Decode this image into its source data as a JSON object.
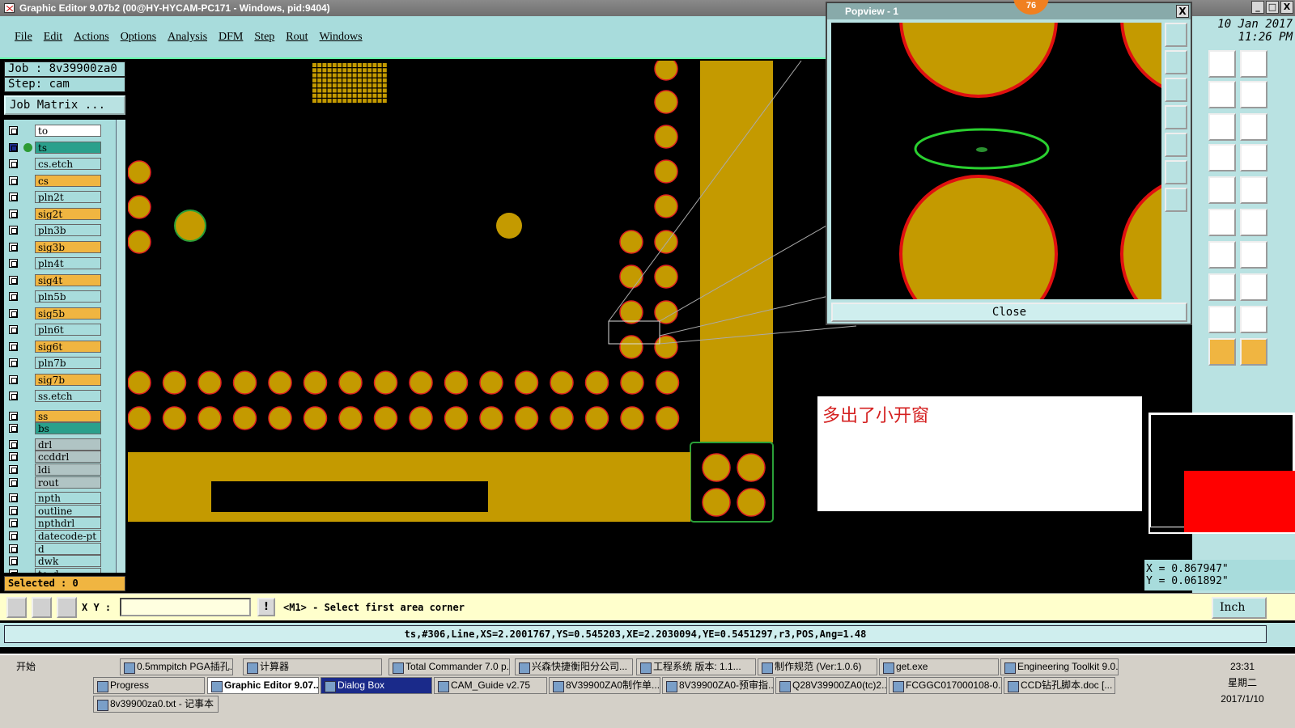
{
  "app": {
    "title": "Graphic Editor 9.07b2 (00@HY-HYCAM-PC171 - Windows, pid:9404)",
    "win_buttons": [
      "_",
      "□",
      "X"
    ]
  },
  "menu": [
    "File",
    "Edit",
    "Actions",
    "Options",
    "Analysis",
    "DFM",
    "Step",
    "Rout",
    "Windows"
  ],
  "job": {
    "label": "Job  : 8v39900za0",
    "step": "Step: cam",
    "matrix": "Job Matrix ..."
  },
  "layers": [
    {
      "name": "to",
      "color": "#ffffff"
    },
    {
      "name": "ts",
      "color": "#2aa08c",
      "active": true
    },
    {
      "name": "cs.etch",
      "color": "#a8dcdc"
    },
    {
      "name": "cs",
      "color": "#f0b541"
    },
    {
      "name": "pln2t",
      "color": "#a8dcdc"
    },
    {
      "name": "sig2t",
      "color": "#f0b541"
    },
    {
      "name": "pln3b",
      "color": "#a8dcdc"
    },
    {
      "name": "sig3b",
      "color": "#f0b541"
    },
    {
      "name": "pln4t",
      "color": "#a8dcdc"
    },
    {
      "name": "sig4t",
      "color": "#f0b541"
    },
    {
      "name": "pln5b",
      "color": "#a8dcdc"
    },
    {
      "name": "sig5b",
      "color": "#f0b541"
    },
    {
      "name": "pln6t",
      "color": "#a8dcdc"
    },
    {
      "name": "sig6t",
      "color": "#f0b541"
    },
    {
      "name": "pln7b",
      "color": "#a8dcdc"
    },
    {
      "name": "sig7b",
      "color": "#f0b541"
    },
    {
      "name": "ss.etch",
      "color": "#a8dcdc"
    },
    {
      "name": "ss",
      "color": "#f0b541"
    },
    {
      "name": "bs",
      "color": "#2aa08c"
    },
    {
      "name": "drl",
      "color": "#b0c4c4"
    },
    {
      "name": "ccddrl",
      "color": "#b0c4c4"
    },
    {
      "name": "ldi",
      "color": "#b0c4c4"
    },
    {
      "name": "rout",
      "color": "#b0c4c4"
    },
    {
      "name": "npth",
      "color": "#a8dcdc"
    },
    {
      "name": "outline",
      "color": "#a8dcdc"
    },
    {
      "name": "npthdrl",
      "color": "#a8dcdc"
    },
    {
      "name": "datecode-pt",
      "color": "#a8dcdc"
    },
    {
      "name": "d",
      "color": "#a8dcdc"
    },
    {
      "name": "dwk",
      "color": "#a8dcdc"
    },
    {
      "name": "to_d",
      "color": "#a8dcdc"
    }
  ],
  "selected": "Selected : 0",
  "command": {
    "xy_label": "X Y :",
    "xy_value": "",
    "warn": "!",
    "prompt": "<M1> - Select first area corner",
    "unit": "Inch"
  },
  "status": "ts,#306,Line,XS=2.2001767,YS=0.545203,XE=2.2030094,YE=0.5451297,r3,POS,Ang=1.48",
  "popview": {
    "title": "Popview - 1",
    "close": "Close",
    "badge": "76",
    "x": "X"
  },
  "datetime": {
    "date": "10 Jan 2017",
    "time": "11:26 PM"
  },
  "coords": {
    "x": "X = 0.867947\"",
    "y": "Y = 0.061892\""
  },
  "note": "多出了小开窗",
  "colors": {
    "copper": "#c49a00",
    "pad_ring": "#e02020",
    "green": "#2aa038",
    "panel": "#a8dcdc"
  },
  "taskbar": {
    "start": "开始",
    "clock_time": "23:31",
    "clock_day": "星期二",
    "clock_date": "2017/1/10",
    "row1": [
      "0.5mmpitch PGA插孔...",
      "计算器",
      "Total Commander 7.0 p...",
      "兴森快捷衡阳分公司...",
      "工程系统  版本: 1.1...",
      "制作规范 (Ver:1.0.6)",
      "get.exe",
      "Engineering Toolkit 9.0..."
    ],
    "row2": [
      "Progress",
      "Graphic Editor 9.07...",
      "Dialog Box",
      "CAM_Guide v2.75",
      "8V39900ZA0制作单....",
      "8V39900ZA0-预审指...",
      "Q28V39900ZA0(tc)2...",
      "FCGGC017000108-0...",
      "CCD钻孔脚本.doc [..."
    ],
    "row3": [
      "8v39900za0.txt - 记事本"
    ]
  }
}
